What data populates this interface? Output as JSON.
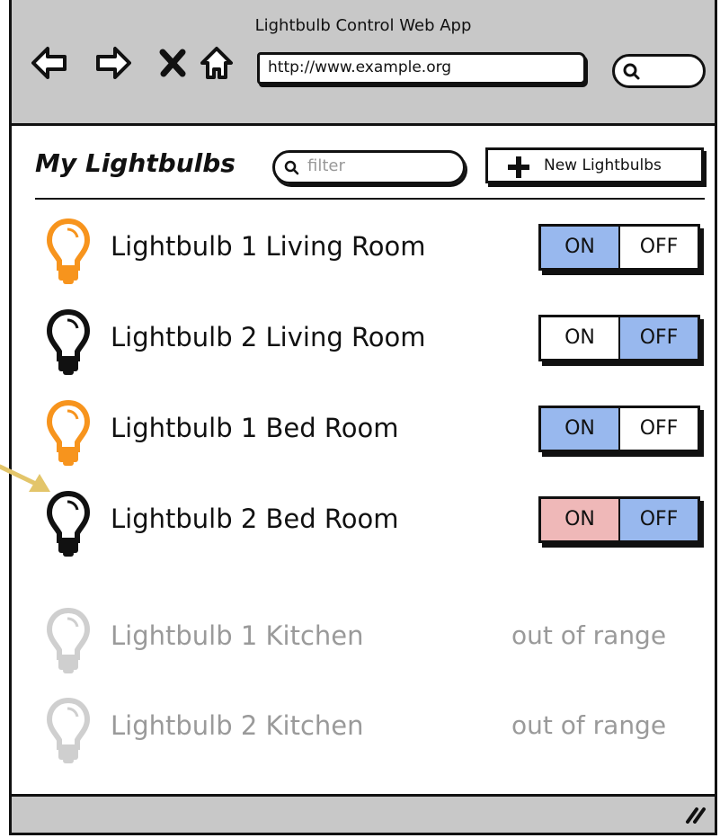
{
  "window": {
    "title": "Lightbulb Control Web App"
  },
  "browser": {
    "url": "http://www.example.org"
  },
  "page": {
    "heading": "My Lightbulbs",
    "filter_placeholder": "filter",
    "new_button_label": "New Lightbulbs"
  },
  "colors": {
    "bulb_on": "#f7941d",
    "toggle_active": "#98b8ee",
    "toggle_warning": "#efb8b8",
    "disabled": "#9a9a9a",
    "chrome": "#c8c8c8",
    "pointer_arrow": "#e3c56a"
  },
  "lightbulbs": [
    {
      "name": "Lightbulb 1 Living Room",
      "state": "on",
      "icon": "lightbulb-on-icon",
      "on_label": "ON",
      "off_label": "OFF"
    },
    {
      "name": "Lightbulb 2 Living Room",
      "state": "off",
      "icon": "lightbulb-off-icon",
      "on_label": "ON",
      "off_label": "OFF"
    },
    {
      "name": "Lightbulb 1 Bed Room",
      "state": "on",
      "icon": "lightbulb-on-icon",
      "on_label": "ON",
      "off_label": "OFF"
    },
    {
      "name": "Lightbulb 2 Bed Room",
      "state": "off",
      "icon": "lightbulb-off-icon",
      "on_label": "ON",
      "off_label": "OFF",
      "on_highlight": "warning"
    },
    {
      "name": "Lightbulb 1 Kitchen",
      "state": "unavailable",
      "icon": "lightbulb-disabled-icon",
      "status": "out of range"
    },
    {
      "name": "Lightbulb 2 Kitchen",
      "state": "unavailable",
      "icon": "lightbulb-disabled-icon",
      "status": "out of range"
    }
  ]
}
